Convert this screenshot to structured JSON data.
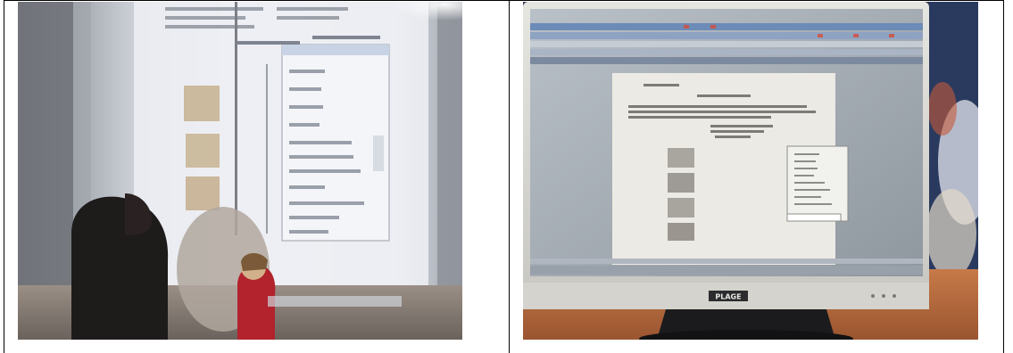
{
  "table": {
    "cells": [
      {
        "kind": "photo",
        "description_name": "classroom-interactive-whiteboard"
      },
      {
        "kind": "photo",
        "description_name": "computer-monitor-document"
      }
    ]
  },
  "monitor": {
    "brand_logo": "PLAGE"
  },
  "colors": {
    "border": "#000000",
    "background": "#ffffff",
    "whiteboard": "#dfe3ea",
    "monitor_bezel": "#d9d9d4",
    "desk": "#c06a3a"
  }
}
